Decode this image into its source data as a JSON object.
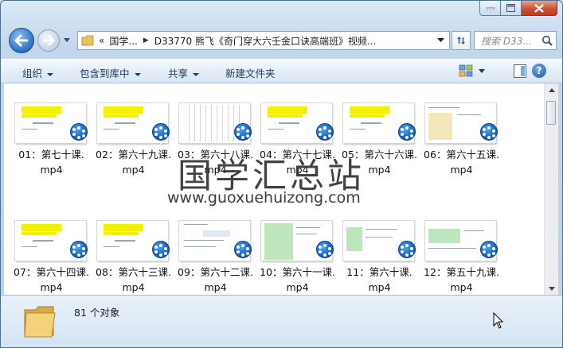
{
  "window": {
    "caption_buttons": {
      "minimize": "minimize-icon",
      "maximize": "maximize-icon",
      "close": "close-icon"
    }
  },
  "nav": {
    "breadcrumb": [
      "«",
      "国学...",
      "D33770 熊飞《奇门穿大六壬金口诀高端班》视频..."
    ],
    "search_placeholder": "搜索 D33..."
  },
  "toolbar": {
    "organize": "组织",
    "include_in_library": "包含到库中",
    "share": "共享",
    "new_folder": "新建文件夹",
    "help": "?"
  },
  "files": [
    {
      "line1": "01：第七十课.",
      "line2": "mp4",
      "style": "yellow"
    },
    {
      "line1": "02：第六十九课.",
      "line2": "mp4",
      "style": "yellow"
    },
    {
      "line1": "03：第六十八课.",
      "line2": "mp4",
      "style": "table"
    },
    {
      "line1": "04：第六十七课.",
      "line2": "mp4",
      "style": "yellow"
    },
    {
      "line1": "05：第六十六课.",
      "line2": "mp4",
      "style": "yellow"
    },
    {
      "line1": "06：第六十五课.",
      "line2": "mp4",
      "style": "grid"
    },
    {
      "line1": "07：第六十四课.",
      "line2": "mp4",
      "style": "yellow"
    },
    {
      "line1": "08：第六十三课.",
      "line2": "mp4",
      "style": "yellow"
    },
    {
      "line1": "09：第六十二课.",
      "line2": "mp4",
      "style": "text"
    },
    {
      "line1": "10：第六十一课.",
      "line2": "mp4",
      "style": "green"
    },
    {
      "line1": "11：第六十课.",
      "line2": "mp4",
      "style": "green2"
    },
    {
      "line1": "12：第五十九课.",
      "line2": "mp4",
      "style": "green3"
    }
  ],
  "watermark": {
    "title": "国学汇总站",
    "url": "www.guoxuehuizong.com"
  },
  "status": {
    "item_count": "81 个对象"
  },
  "colors": {
    "accent": "#1561c4",
    "highlight": "#f3f000",
    "close": "#cf4f34"
  }
}
